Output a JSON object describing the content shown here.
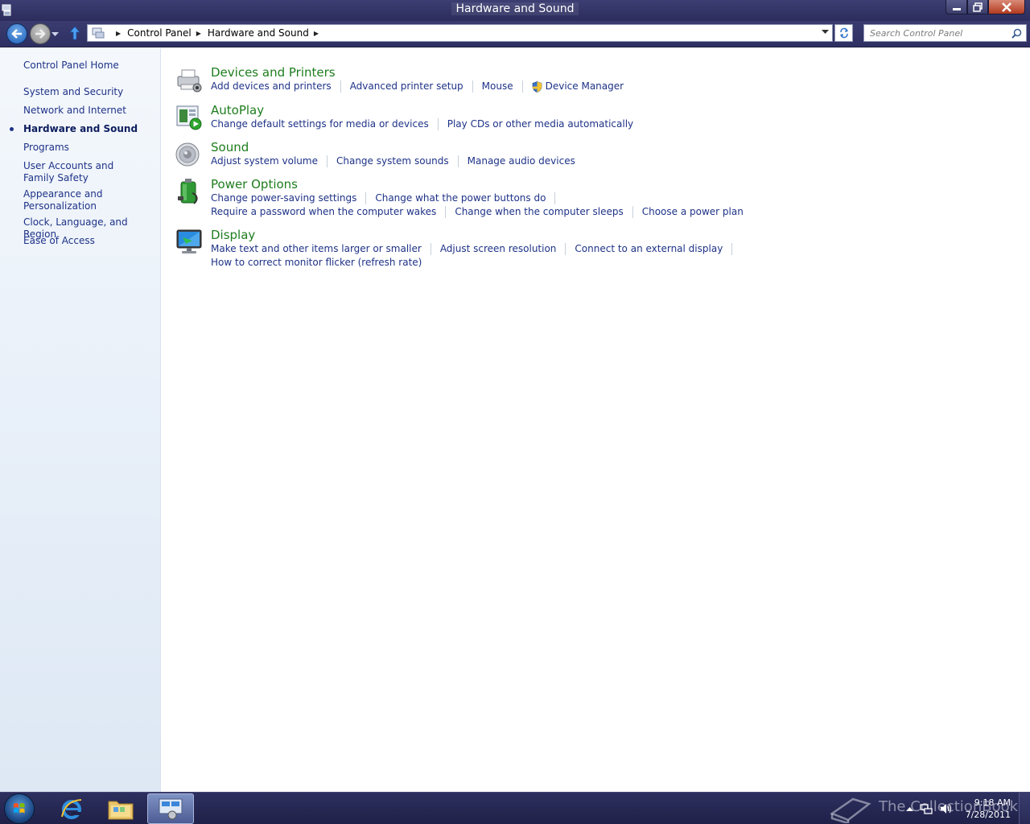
{
  "window": {
    "title": "Hardware and Sound"
  },
  "address": {
    "crumbs": [
      "Control Panel",
      "Hardware and Sound"
    ]
  },
  "search": {
    "placeholder": "Search Control Panel"
  },
  "sidebar": {
    "home": "Control Panel Home",
    "items": [
      {
        "label": "System and Security",
        "current": false
      },
      {
        "label": "Network and Internet",
        "current": false
      },
      {
        "label": "Hardware and Sound",
        "current": true
      },
      {
        "label": "Programs",
        "current": false
      },
      {
        "label": "User Accounts and Family Safety",
        "current": false
      },
      {
        "label": "Appearance and Personalization",
        "current": false
      },
      {
        "label": "Clock, Language, and Region",
        "current": false
      },
      {
        "label": "Ease of Access",
        "current": false
      }
    ]
  },
  "categories": [
    {
      "title": "Devices and Printers",
      "icon": "printer-icon",
      "rows": [
        [
          "Add devices and printers",
          "Advanced printer setup",
          "Mouse",
          "Device Manager"
        ]
      ]
    },
    {
      "title": "AutoPlay",
      "icon": "autoplay-icon",
      "rows": [
        [
          "Change default settings for media or devices",
          "Play CDs or other media automatically"
        ]
      ]
    },
    {
      "title": "Sound",
      "icon": "speaker-icon",
      "rows": [
        [
          "Adjust system volume",
          "Change system sounds",
          "Manage audio devices"
        ]
      ]
    },
    {
      "title": "Power Options",
      "icon": "battery-icon",
      "rows": [
        [
          "Change power-saving settings",
          "Change what the power buttons do"
        ],
        [
          "Require a password when the computer wakes",
          "Change when the computer sleeps",
          "Choose a power plan"
        ]
      ]
    },
    {
      "title": "Display",
      "icon": "monitor-icon",
      "rows": [
        [
          "Make text and other items larger or smaller",
          "Adjust screen resolution",
          "Connect to an external display"
        ],
        [
          "How to correct monitor flicker (refresh rate)"
        ]
      ]
    }
  ],
  "taskbar": {
    "watermark": "The CollectionBook",
    "time": "9:18 AM",
    "date": "7/28/2011"
  },
  "colors": {
    "heading_green": "#1e7d1e",
    "link_blue": "#1e3287",
    "titlebar": "#2c2d5c"
  }
}
